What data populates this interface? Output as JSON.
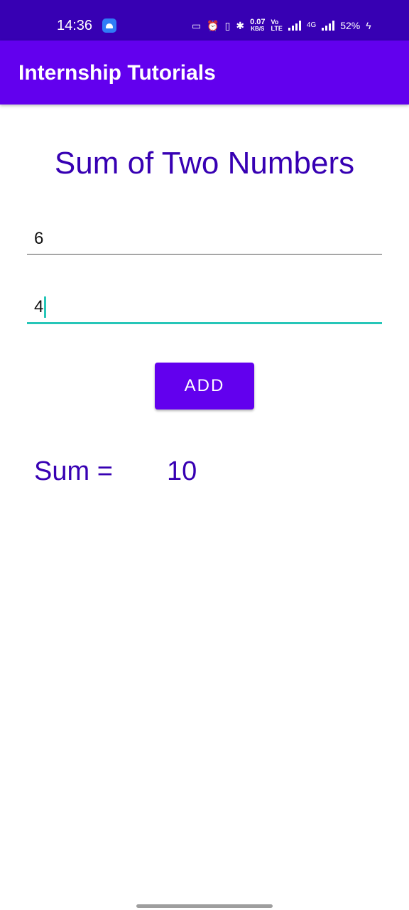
{
  "status_bar": {
    "time": "14:36",
    "net_speed_value": "0.07",
    "net_speed_unit": "KB/S",
    "volte_top": "Vo",
    "volte_bottom": "LTE",
    "network_type": "4G",
    "battery": "52%"
  },
  "app_bar": {
    "title": "Internship Tutorials"
  },
  "main": {
    "heading": "Sum of Two Numbers",
    "first_number": "6",
    "second_number": "4",
    "add_label": "ADD",
    "sum_label": "Sum =",
    "sum_value": "10"
  },
  "colors": {
    "status_bar": "#3700b3",
    "app_bar": "#6200ee",
    "accent": "#26c6b8",
    "text_primary": "#3700b3"
  }
}
